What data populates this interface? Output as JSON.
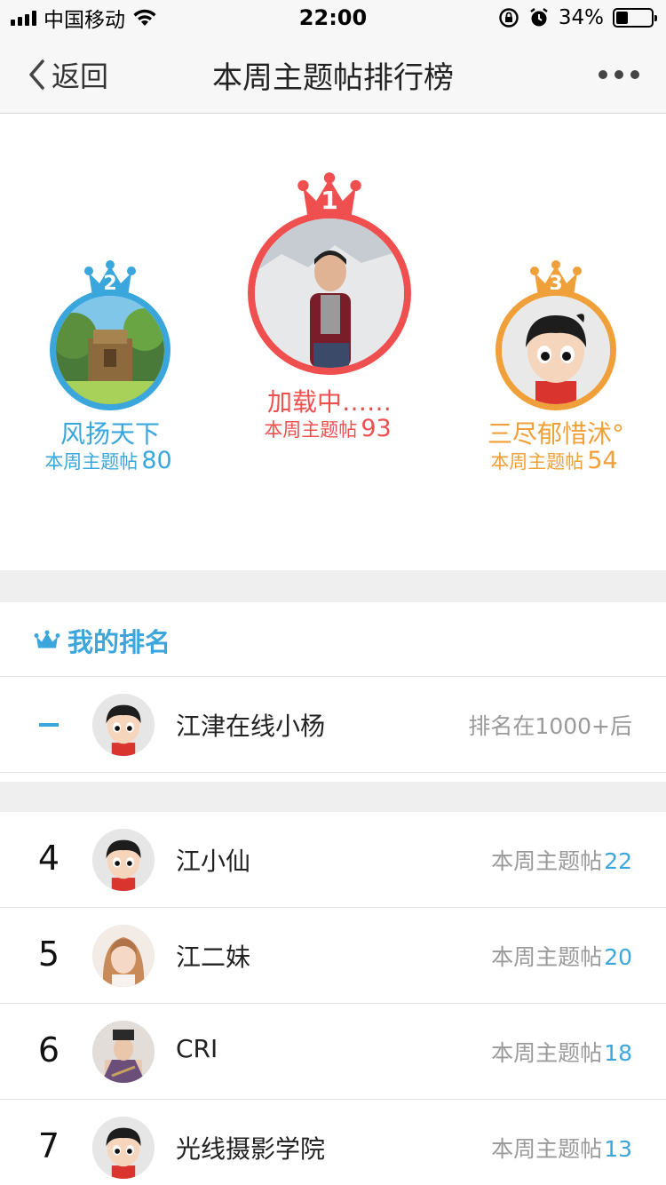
{
  "status_bar": {
    "carrier": "中国移动",
    "time": "22:00",
    "battery_percent": "34%",
    "battery_level": 0.34,
    "icons": [
      "signal-icon",
      "wifi-icon",
      "rotation-lock-icon",
      "alarm-icon",
      "battery-icon"
    ]
  },
  "nav": {
    "back_label": "返回",
    "title": "本周主题帖排行榜",
    "back_icon": "chevron-left-icon",
    "more_icon": "more-icon"
  },
  "podium": {
    "first": {
      "rank": "1",
      "name": "加载中……",
      "count_label": "本周主题帖",
      "count": "93",
      "color": "#ef4f4f"
    },
    "second": {
      "rank": "2",
      "name": "风扬天下",
      "count_label": "本周主题帖",
      "count": "80",
      "color": "#3aa6dc"
    },
    "third": {
      "rank": "3",
      "name": "三尽郁惜沭°",
      "count_label": "本周主题帖",
      "count": "54",
      "color": "#f0a03a"
    }
  },
  "my_rank": {
    "title": "我的排名",
    "rank": "–",
    "name": "江津在线小杨",
    "status": "排名在1000+后",
    "accent": "#3aa6dc"
  },
  "list": [
    {
      "rank": "4",
      "name": "江小仙",
      "count_label": "本周主题帖",
      "count": "22"
    },
    {
      "rank": "5",
      "name": "江二妹",
      "count_label": "本周主题帖",
      "count": "20"
    },
    {
      "rank": "6",
      "name": "CRI",
      "count_label": "本周主题帖",
      "count": "18"
    },
    {
      "rank": "7",
      "name": "光线摄影学院",
      "count_label": "本周主题帖",
      "count": "13"
    }
  ]
}
